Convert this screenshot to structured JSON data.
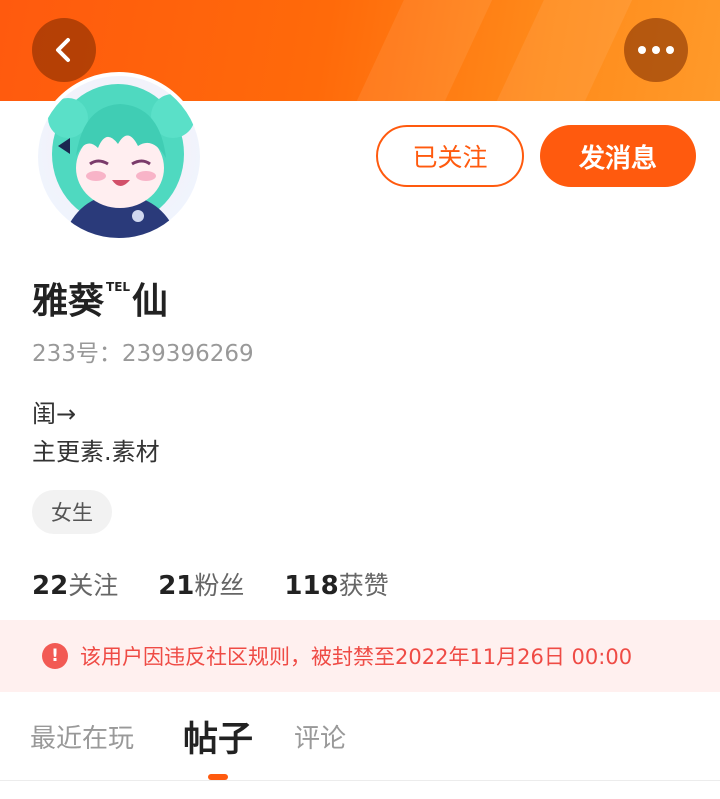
{
  "header": {
    "back_icon": "chevron-left-icon",
    "more_icon": "more-horizontal-icon"
  },
  "profile": {
    "avatar_alt": "anime-girl-avatar",
    "follow_label": "已关注",
    "message_label": "发消息",
    "name_part1": "雅葵",
    "name_sup": "TEL",
    "name_part2": "仙",
    "uid_label": "233号：",
    "uid_value": "239396269",
    "bio_line1": "闺→",
    "bio_line2": "主更素.素材",
    "gender_tag": "女生"
  },
  "stats": [
    {
      "num": "22",
      "label": "关注"
    },
    {
      "num": "21",
      "label": "粉丝"
    },
    {
      "num": "118",
      "label": "获赞"
    }
  ],
  "ban_notice": {
    "icon": "!",
    "text": "该用户因违反社区规则，被封禁至2022年11月26日 00:00"
  },
  "tabs": [
    {
      "label": "最近在玩",
      "active": false
    },
    {
      "label": "帖子",
      "active": true
    },
    {
      "label": "评论",
      "active": false
    }
  ],
  "colors": {
    "accent": "#ff5a0e",
    "ban_bg": "#fff0ef",
    "ban_text": "#ef4b45"
  }
}
